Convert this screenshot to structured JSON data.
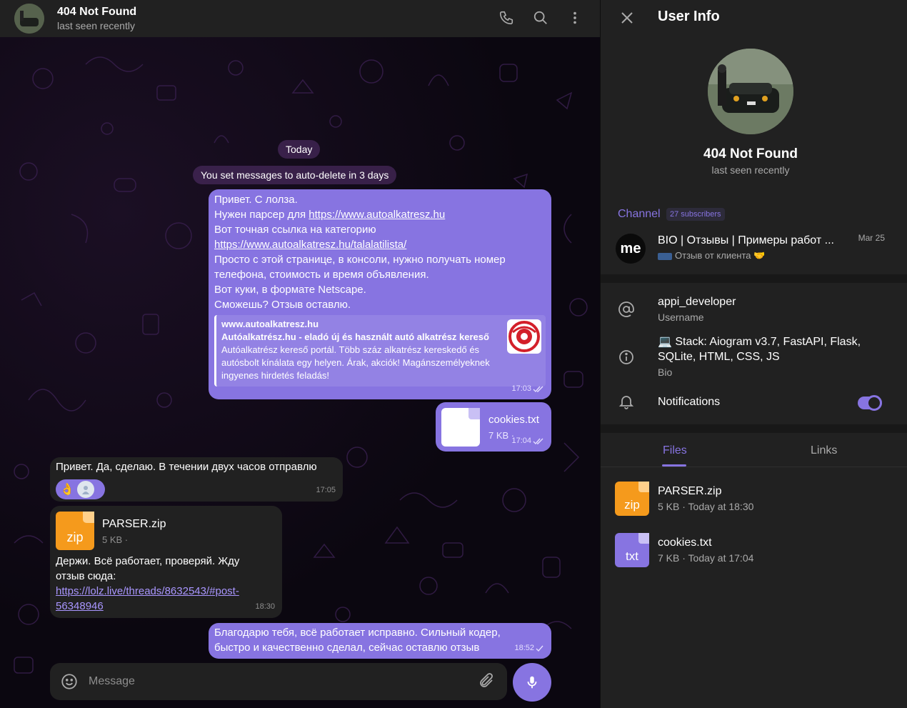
{
  "chat": {
    "title": "404 Not Found",
    "status": "last seen recently",
    "date_pill": "Today",
    "service_message": "You set messages to auto-delete in 3 days",
    "messages": {
      "m1": {
        "lines": [
          "Привет. С лолза.",
          "Нужен парсер для ",
          "https://www.autoalkatresz.hu",
          "Вот точная ссылка на категорию",
          "https://www.autoalkatresz.hu/talalatilista/",
          "Просто с этой странице, в консоли, нужно получать номер",
          "телефона, стоимость и время объявления.",
          "Вот куки, в формате Netscape.",
          "Сможешь? Отзыв оставлю."
        ],
        "preview_site": "www.autoalkatresz.hu",
        "preview_title": "Autóalkatrész.hu - eladó új és használt autó alkatrész kereső",
        "preview_desc": "Autóalkatrész kereső portál. Több száz alkatrész kereskedő és autósbolt kínálata egy helyen. Árak, akciók! Magánszemélyeknek ingyenes hirdetés feladás!",
        "time": "17:03"
      },
      "m2": {
        "file_name": "cookies.txt",
        "file_size": "7 KB ·",
        "time": "17:04"
      },
      "m3": {
        "text": "Привет. Да, сделаю. В течении двух часов отправлю",
        "reaction": "👌",
        "time": "17:05"
      },
      "m4": {
        "file_name": "PARSER.zip",
        "file_size": "5 KB ·",
        "file_ext": "zip",
        "text1": "Держи. Всё работает, проверяй. Жду",
        "text2": "отзыв сюда:",
        "link1": "https://lolz.live/threads/8632543/#post-",
        "link2": "56348946",
        "time": "18:30"
      },
      "m5": {
        "line1": "Благодарю тебя, всё работает исправно. Сильный кодер,",
        "line2": "быстро и качественно сделал, сейчас оставлю отзыв",
        "time": "18:52"
      }
    },
    "composer_placeholder": "Message"
  },
  "info": {
    "title": "User Info",
    "name": "404 Not Found",
    "status": "last seen recently",
    "channel_label": "Channel",
    "channel_subscribers": "27 subscribers",
    "channel_avatar_text": "me",
    "channel_title": "BIO | Отзывы | Примеры работ ...",
    "channel_last": "Отзыв от клиента 🤝",
    "channel_date": "Mar 25",
    "username": "appi_developer",
    "username_label": "Username",
    "bio_line1": "💻 Stack: Aiogram v3.7, FastAPI, Flask,",
    "bio_line2": "SQLite, HTML, CSS, JS",
    "bio_label": "Bio",
    "notifications": "Notifications",
    "notifications_on": true,
    "tabs": [
      "Files",
      "Links"
    ],
    "files": [
      {
        "ext": "zip",
        "name": "PARSER.zip",
        "meta": "5 KB · Today at 18:30"
      },
      {
        "ext": "txt",
        "name": "cookies.txt",
        "meta": "7 KB · Today at 17:04"
      }
    ]
  },
  "colors": {
    "accent": "#8774e1",
    "panel": "#212121",
    "zip": "#f59a1c"
  }
}
